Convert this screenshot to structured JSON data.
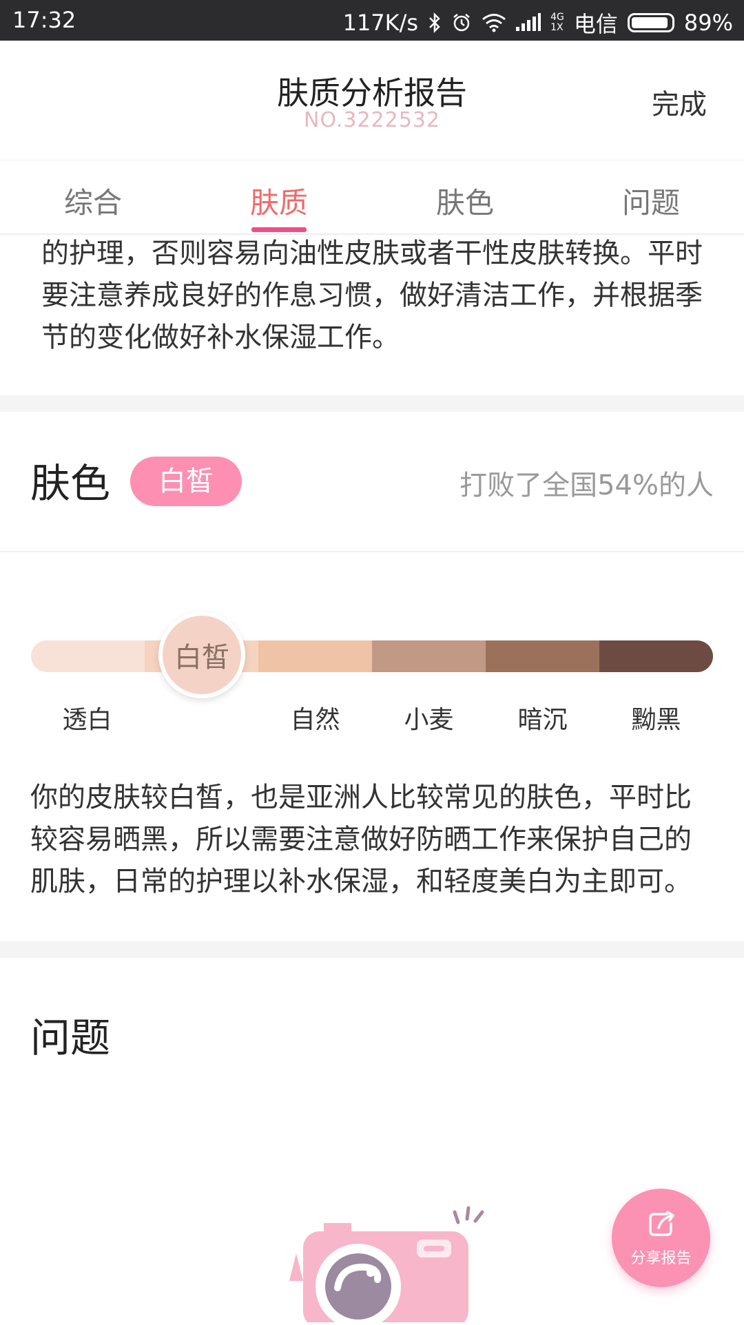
{
  "status_bar": {
    "time": "17:32",
    "speed": "117K/s",
    "network_top": "4G",
    "network_bottom": "1X",
    "carrier": "电信",
    "battery": "89%"
  },
  "header": {
    "title": "肤质分析报告",
    "report_no": "NO.3222532",
    "done_label": "完成"
  },
  "tabs": [
    {
      "label": "综合"
    },
    {
      "label": "肤质",
      "active": true
    },
    {
      "label": "肤色"
    },
    {
      "label": "问题"
    }
  ],
  "skin_type_paragraph": "的护理，否则容易向油性皮肤或者干性皮肤转换。平时要注意养成良好的作息习惯，做好清洁工作，并根据季节的变化做好补水保湿工作。",
  "skin_color": {
    "title": "肤色",
    "badge": "白皙",
    "rank_text": "打败了全国54%的人",
    "marker_label": "白皙",
    "scale": [
      {
        "label": "透白",
        "color": "#f8e1d6"
      },
      {
        "label": "白皙",
        "color": "#f5d3bf"
      },
      {
        "label": "自然",
        "color": "#eec3a6"
      },
      {
        "label": "小麦",
        "color": "#c19985"
      },
      {
        "label": "暗沉",
        "color": "#9b715b"
      },
      {
        "label": "黝黑",
        "color": "#6e4b42"
      }
    ],
    "selected_index": 1,
    "description": "你的皮肤较白皙，也是亚洲人比较常见的肤色，平时比较容易晒黑，所以需要注意做好防晒工作来保护自己的肌肤，日常的护理以补水保湿，和轻度美白为主即可。"
  },
  "problems": {
    "title": "问题"
  },
  "share_button": {
    "label": "分享报告"
  },
  "colors": {
    "accent_pink": "#fd8fb3",
    "tab_active": "#f06a6a",
    "tab_underline": "#f04e85"
  }
}
